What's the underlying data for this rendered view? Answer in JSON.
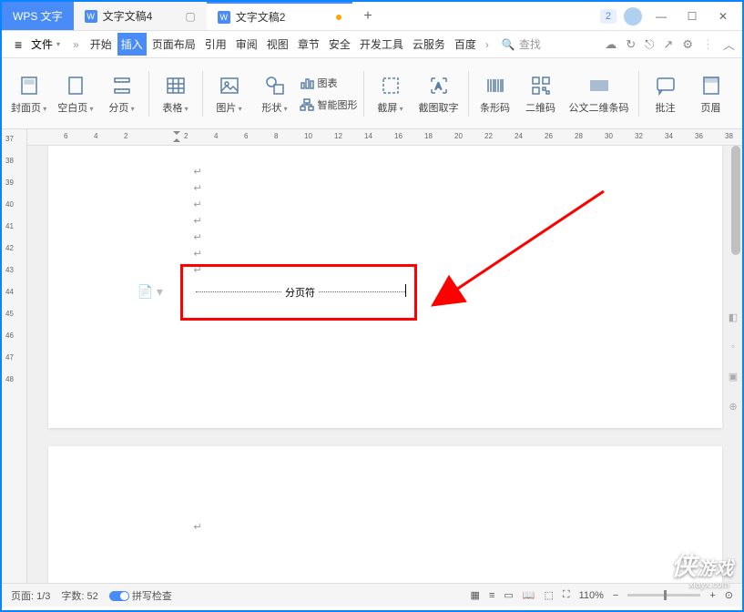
{
  "app": {
    "name": "WPS 文字"
  },
  "tabs": [
    {
      "label": "文字文稿4"
    },
    {
      "label": "文字文稿2",
      "modified": true
    }
  ],
  "titlebar": {
    "user_badge": "2"
  },
  "menu": {
    "file": "文件",
    "items": [
      "开始",
      "插入",
      "页面布局",
      "引用",
      "审阅",
      "视图",
      "章节",
      "安全",
      "开发工具",
      "云服务",
      "百度"
    ],
    "search": "查找"
  },
  "ribbon": {
    "cover": "封面页",
    "blank": "空白页",
    "pagebreak": "分页",
    "table": "表格",
    "picture": "图片",
    "shape": "形状",
    "chart": "图表",
    "smartart": "智能图形",
    "screenshot": "截屏",
    "ocr": "截图取字",
    "barcode": "条形码",
    "qrcode": "二维码",
    "gov_barcode": "公文二维条码",
    "comment": "批注",
    "header": "页眉"
  },
  "ruler": {
    "h": [
      "6",
      "4",
      "2",
      "",
      "2",
      "4",
      "6",
      "8",
      "10",
      "12",
      "14",
      "16",
      "18",
      "20",
      "22",
      "24",
      "26",
      "28",
      "30",
      "32",
      "34",
      "36",
      "38"
    ],
    "v": [
      "37",
      "38",
      "39",
      "40",
      "41",
      "42",
      "43",
      "44",
      "45",
      "46",
      "47",
      "48"
    ]
  },
  "document": {
    "page_break_label": "分页符"
  },
  "status": {
    "page": "页面: 1/3",
    "words": "字数: 52",
    "spellcheck": "拼写检查",
    "zoom": "110%"
  },
  "watermark": {
    "brand": "侠",
    "brand2": "游戏",
    "url": "xiayx.com"
  }
}
